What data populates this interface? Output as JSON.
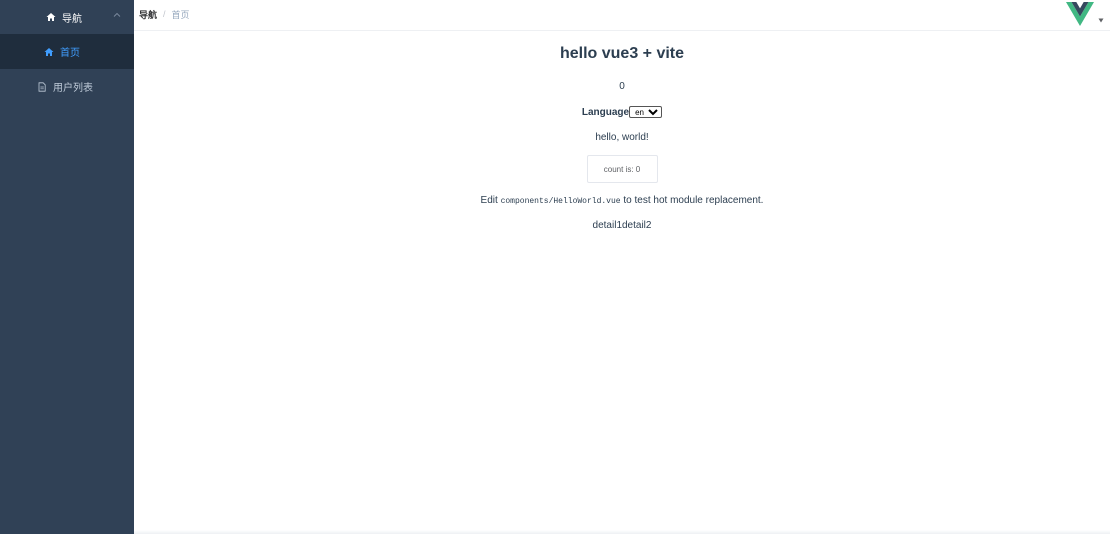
{
  "sidebar": {
    "group": {
      "label": "导航",
      "icon": "home-icon"
    },
    "items": [
      {
        "label": "首页",
        "icon": "home-icon",
        "active": true
      },
      {
        "label": "用户列表",
        "icon": "document-icon",
        "active": false
      }
    ],
    "colors": {
      "background": "#304156",
      "active_bg": "#1f2d3d",
      "active_text": "#409eff",
      "text": "#bfcbd9"
    }
  },
  "header": {
    "breadcrumb": {
      "first": "导航",
      "separator": "/",
      "current": "首页"
    },
    "avatar_icon": "vue-logo-icon"
  },
  "main": {
    "title": "hello vue3 + vite",
    "value": "0",
    "language": {
      "label": "Language",
      "selected": "en"
    },
    "greeting": "hello, world!",
    "count_button": "count is: 0",
    "edit": {
      "prefix": "Edit ",
      "code": "components/HelloWorld.vue",
      "suffix": " to test hot module replacement."
    },
    "links": {
      "first": "detail1",
      "second": "detail2"
    }
  }
}
